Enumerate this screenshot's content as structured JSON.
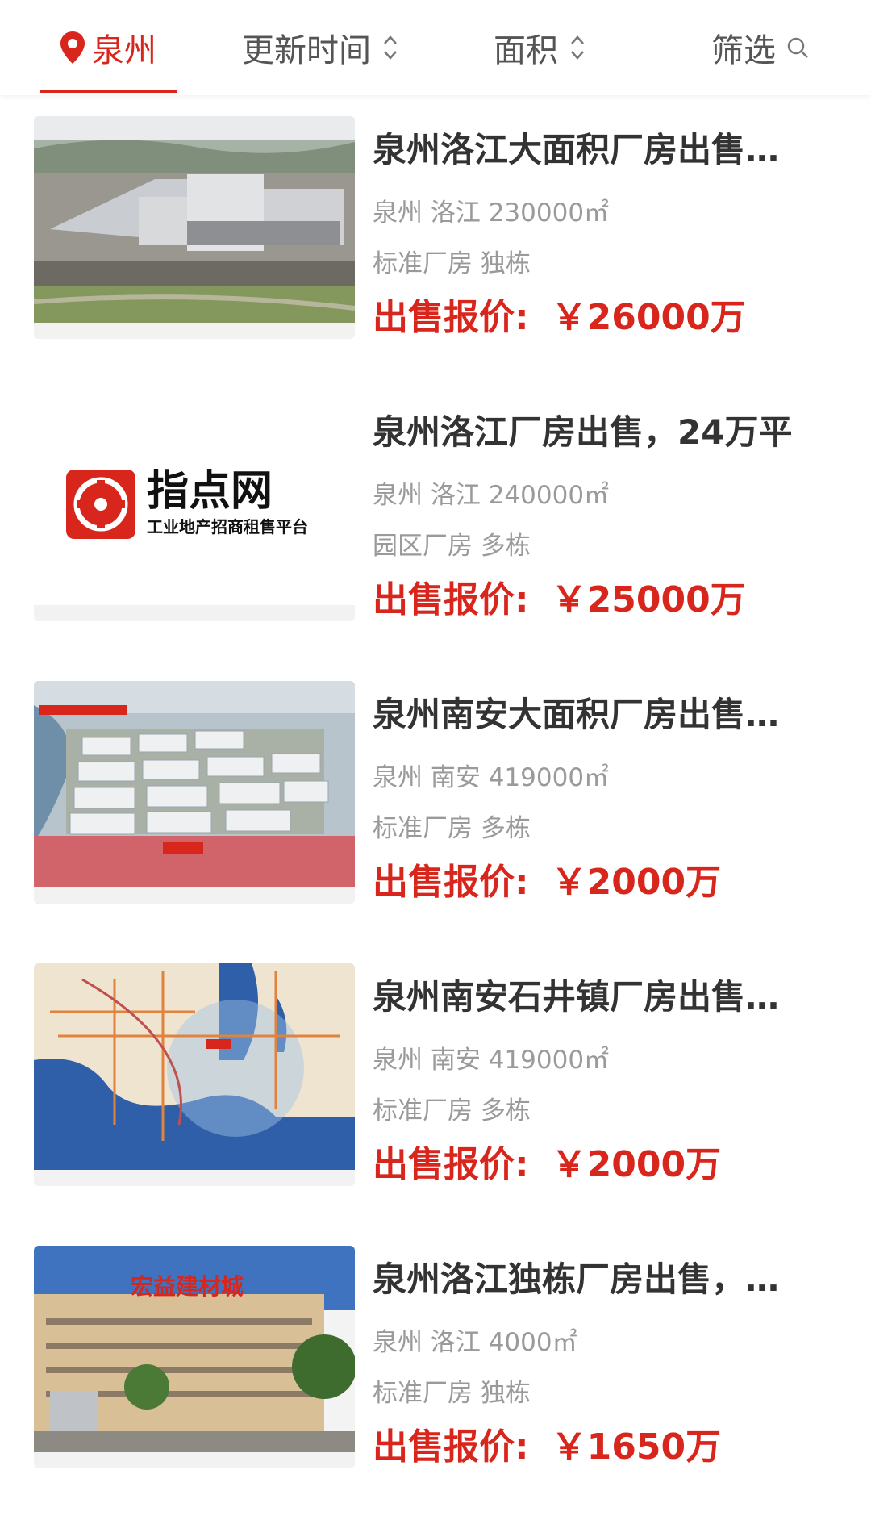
{
  "filter_bar": {
    "city": "泉州",
    "sort_update": "更新时间",
    "sort_area": "面积",
    "screen": "筛选"
  },
  "colors": {
    "accent": "#d9261c",
    "title": "#333333",
    "meta": "#9a9a9a"
  },
  "listings": [
    {
      "title": "泉州洛江大面积厂房出售…",
      "location": "泉州 洛江 230000㎡",
      "type": "标准厂房 独栋",
      "price_label": "出售报价:",
      "price": "￥26000万",
      "image": "factory-aerial-photo"
    },
    {
      "title": "泉州洛江厂房出售，24万平",
      "location": "泉州 洛江 240000㎡",
      "type": "园区厂房 多栋",
      "price_label": "出售报价:",
      "price": "￥25000万",
      "image": "zhidian-logo",
      "logo_name": "指点网",
      "logo_tagline": "工业地产招商租售平台"
    },
    {
      "title": "泉州南安大面积厂房出售…",
      "location": "泉州 南安 419000㎡",
      "type": "标准厂房 多栋",
      "price_label": "出售报价:",
      "price": "￥2000万",
      "image": "industrial-park-render"
    },
    {
      "title": "泉州南安石井镇厂房出售…",
      "location": "泉州 南安 419000㎡",
      "type": "标准厂房 多栋",
      "price_label": "出售报价:",
      "price": "￥2000万",
      "image": "location-map"
    },
    {
      "title": "泉州洛江独栋厂房出售，…",
      "location": "泉州 洛江 4000㎡",
      "type": "标准厂房 独栋",
      "price_label": "出售报价:",
      "price": "￥1650万",
      "image": "building-materials-city-photo",
      "sign_text": "宏益建材城"
    }
  ]
}
